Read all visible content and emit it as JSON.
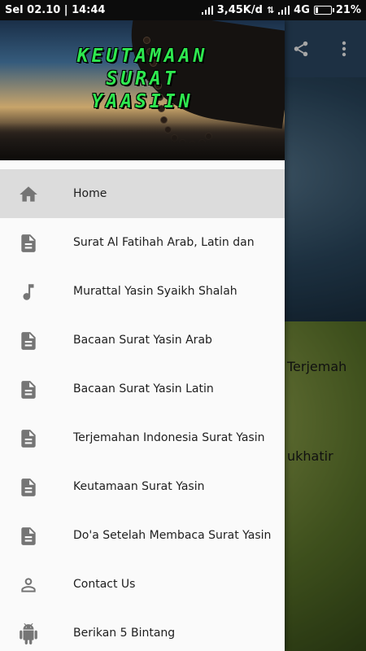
{
  "status_bar": {
    "left": "Sel 02.10 | 14:44",
    "speed": "3,45K/d",
    "network": "4G",
    "battery": "21%",
    "battery_level": 0.21
  },
  "background_app": {
    "share_icon": "share-icon",
    "more_icon": "more-vert-icon",
    "text_1": "Terjemah",
    "text_2": "ukhatir"
  },
  "drawer": {
    "header_title_lines": [
      "KEUTAMAAN",
      "SURAT",
      "YAASIIN"
    ],
    "items": [
      {
        "label": "Home",
        "icon": "home-icon",
        "active": true
      },
      {
        "label": "Surat Al Fatihah Arab, Latin dan",
        "icon": "document-icon"
      },
      {
        "label": "Murattal Yasin Syaikh Shalah",
        "icon": "music-note-icon"
      },
      {
        "label": "Bacaan Surat Yasin Arab",
        "icon": "document-icon"
      },
      {
        "label": "Bacaan Surat Yasin Latin",
        "icon": "document-icon"
      },
      {
        "label": "Terjemahan Indonesia Surat Yasin",
        "icon": "document-icon"
      },
      {
        "label": "Keutamaan Surat Yasin",
        "icon": "document-icon"
      },
      {
        "label": "Do'a Setelah Membaca Surat Yasin",
        "icon": "document-icon"
      },
      {
        "label": "Contact Us",
        "icon": "person-icon"
      },
      {
        "label": "Berikan 5 Bintang",
        "icon": "android-icon"
      }
    ]
  },
  "colors": {
    "appbar": "#2d4a68",
    "title_green": "#2ee84f",
    "active_item": "#dcdcdc",
    "icon_gray": "#6e6e6e"
  }
}
